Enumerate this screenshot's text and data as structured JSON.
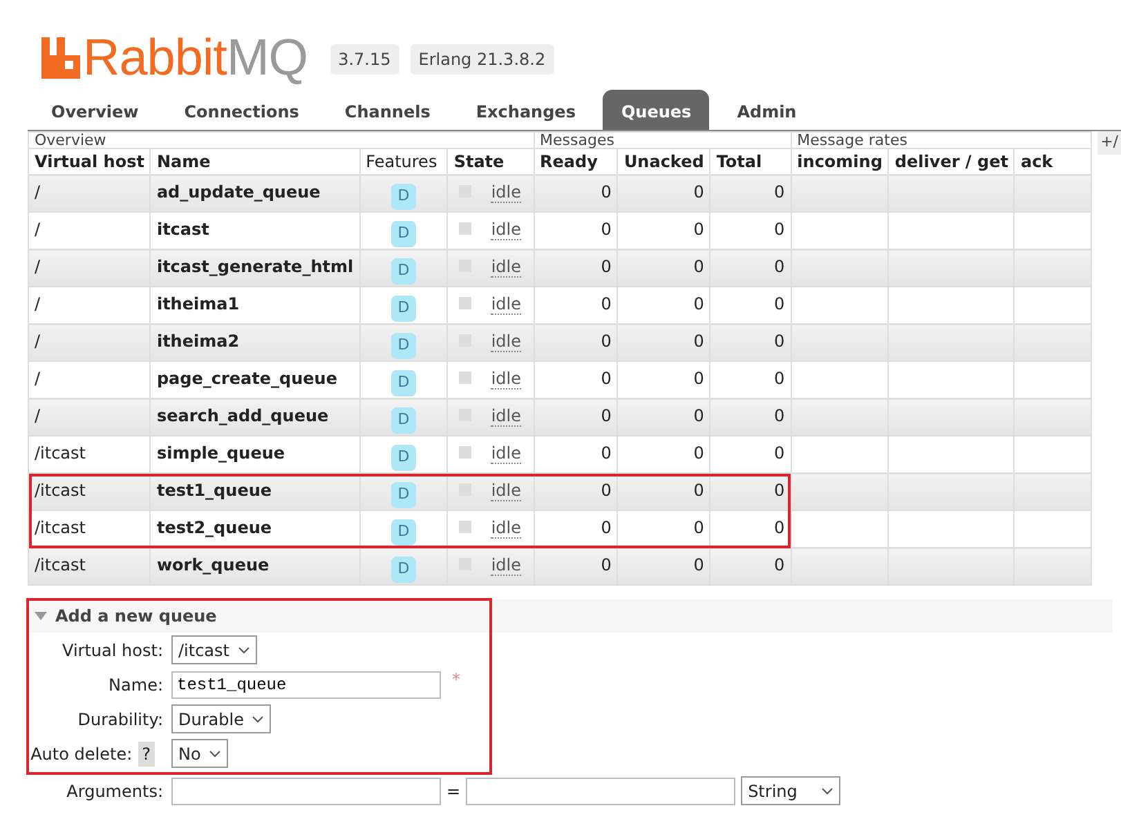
{
  "header": {
    "brand": "Rabbit",
    "brand_suffix": "MQ",
    "version": "3.7.15",
    "erlang": "Erlang 21.3.8.2"
  },
  "tabs": [
    {
      "label": "Overview",
      "selected": false
    },
    {
      "label": "Connections",
      "selected": false
    },
    {
      "label": "Channels",
      "selected": false
    },
    {
      "label": "Exchanges",
      "selected": false
    },
    {
      "label": "Queues",
      "selected": true
    },
    {
      "label": "Admin",
      "selected": false
    }
  ],
  "table": {
    "group_headers": [
      {
        "label": "Overview"
      },
      {
        "label": "Messages"
      },
      {
        "label": "Message rates"
      }
    ],
    "toggle": "+/",
    "columns": [
      {
        "label": "Virtual host",
        "bold": true
      },
      {
        "label": "Name",
        "bold": true
      },
      {
        "label": "Features",
        "bold": false
      },
      {
        "label": "State",
        "bold": true
      },
      {
        "label": "Ready",
        "bold": true
      },
      {
        "label": "Unacked",
        "bold": true
      },
      {
        "label": "Total",
        "bold": true
      },
      {
        "label": "incoming",
        "bold": true
      },
      {
        "label": "deliver / get",
        "bold": true
      },
      {
        "label": "ack",
        "bold": true
      }
    ],
    "rows": [
      {
        "vhost": "/",
        "name": "ad_update_queue",
        "feature": "D",
        "state": "idle",
        "ready": "0",
        "unacked": "0",
        "total": "0",
        "highlighted": false
      },
      {
        "vhost": "/",
        "name": "itcast",
        "feature": "D",
        "state": "idle",
        "ready": "0",
        "unacked": "0",
        "total": "0",
        "highlighted": false
      },
      {
        "vhost": "/",
        "name": "itcast_generate_html",
        "feature": "D",
        "state": "idle",
        "ready": "0",
        "unacked": "0",
        "total": "0",
        "highlighted": false
      },
      {
        "vhost": "/",
        "name": "itheima1",
        "feature": "D",
        "state": "idle",
        "ready": "0",
        "unacked": "0",
        "total": "0",
        "highlighted": false
      },
      {
        "vhost": "/",
        "name": "itheima2",
        "feature": "D",
        "state": "idle",
        "ready": "0",
        "unacked": "0",
        "total": "0",
        "highlighted": false
      },
      {
        "vhost": "/",
        "name": "page_create_queue",
        "feature": "D",
        "state": "idle",
        "ready": "0",
        "unacked": "0",
        "total": "0",
        "highlighted": false
      },
      {
        "vhost": "/",
        "name": "search_add_queue",
        "feature": "D",
        "state": "idle",
        "ready": "0",
        "unacked": "0",
        "total": "0",
        "highlighted": false
      },
      {
        "vhost": "/itcast",
        "name": "simple_queue",
        "feature": "D",
        "state": "idle",
        "ready": "0",
        "unacked": "0",
        "total": "0",
        "highlighted": false
      },
      {
        "vhost": "/itcast",
        "name": "test1_queue",
        "feature": "D",
        "state": "idle",
        "ready": "0",
        "unacked": "0",
        "total": "0",
        "highlighted": true
      },
      {
        "vhost": "/itcast",
        "name": "test2_queue",
        "feature": "D",
        "state": "idle",
        "ready": "0",
        "unacked": "0",
        "total": "0",
        "highlighted": true
      },
      {
        "vhost": "/itcast",
        "name": "work_queue",
        "feature": "D",
        "state": "idle",
        "ready": "0",
        "unacked": "0",
        "total": "0",
        "highlighted": false
      }
    ]
  },
  "form": {
    "title": "Add a new queue",
    "expanded": true,
    "highlighted": true,
    "fields": [
      {
        "kind": "select",
        "label": "Virtual host:",
        "value": "/itcast"
      },
      {
        "kind": "text",
        "label": "Name:",
        "value": "test1_queue",
        "required_mark": "*"
      },
      {
        "kind": "select",
        "label": "Durability:",
        "value": "Durable"
      },
      {
        "kind": "select",
        "label": "Auto delete:",
        "help": "?",
        "value": "No"
      }
    ],
    "arguments": {
      "label": "Arguments:",
      "equals": "=",
      "type": "String"
    }
  }
}
